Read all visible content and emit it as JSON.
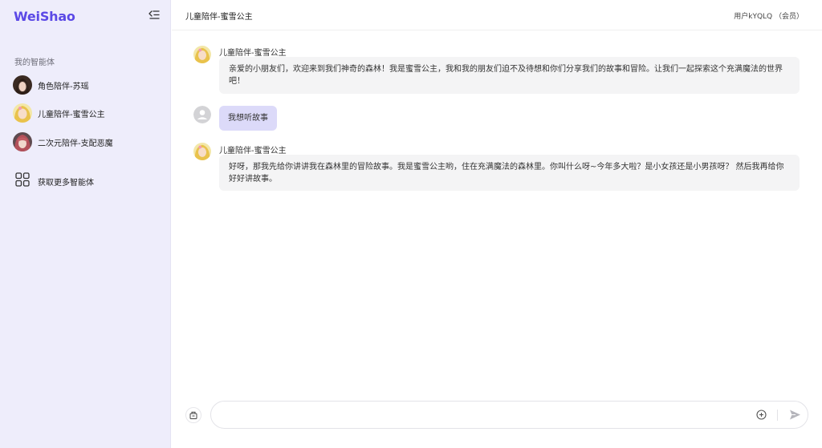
{
  "app": {
    "logo": "WeiShao"
  },
  "sidebar": {
    "section_title": "我的智能体",
    "agents": [
      {
        "label": "角色陪伴-苏瑶"
      },
      {
        "label": "儿童陪伴-蜜雪公主"
      },
      {
        "label": "二次元陪伴-支配恶魔"
      }
    ],
    "more_label": "获取更多智能体"
  },
  "header": {
    "title": "儿童陪伴-蜜雪公主",
    "user": "用户kYQLQ （会员）"
  },
  "messages": [
    {
      "role": "assistant",
      "name": "儿童陪伴-蜜雪公主",
      "text": "亲爱的小朋友们，欢迎来到我们神奇的森林！我是蜜雪公主，我和我的朋友们迫不及待想和你们分享我们的故事和冒险。让我们一起探索这个充满魔法的世界吧！"
    },
    {
      "role": "user",
      "text": "我想听故事"
    },
    {
      "role": "assistant",
      "name": "儿童陪伴-蜜雪公主",
      "text": "好呀，那我先给你讲讲我在森林里的冒险故事。我是蜜雪公主哟，住在充满魔法的森林里。你叫什么呀~今年多大啦？是小女孩还是小男孩呀？ 然后我再给你好好讲故事。"
    }
  ],
  "input": {
    "value": "",
    "placeholder": ""
  },
  "colors": {
    "accent": "#5b49e6",
    "sidebar_bg": "#eeedfb",
    "user_bubble": "#dcdaf9",
    "assistant_bubble": "#f4f4f5"
  }
}
